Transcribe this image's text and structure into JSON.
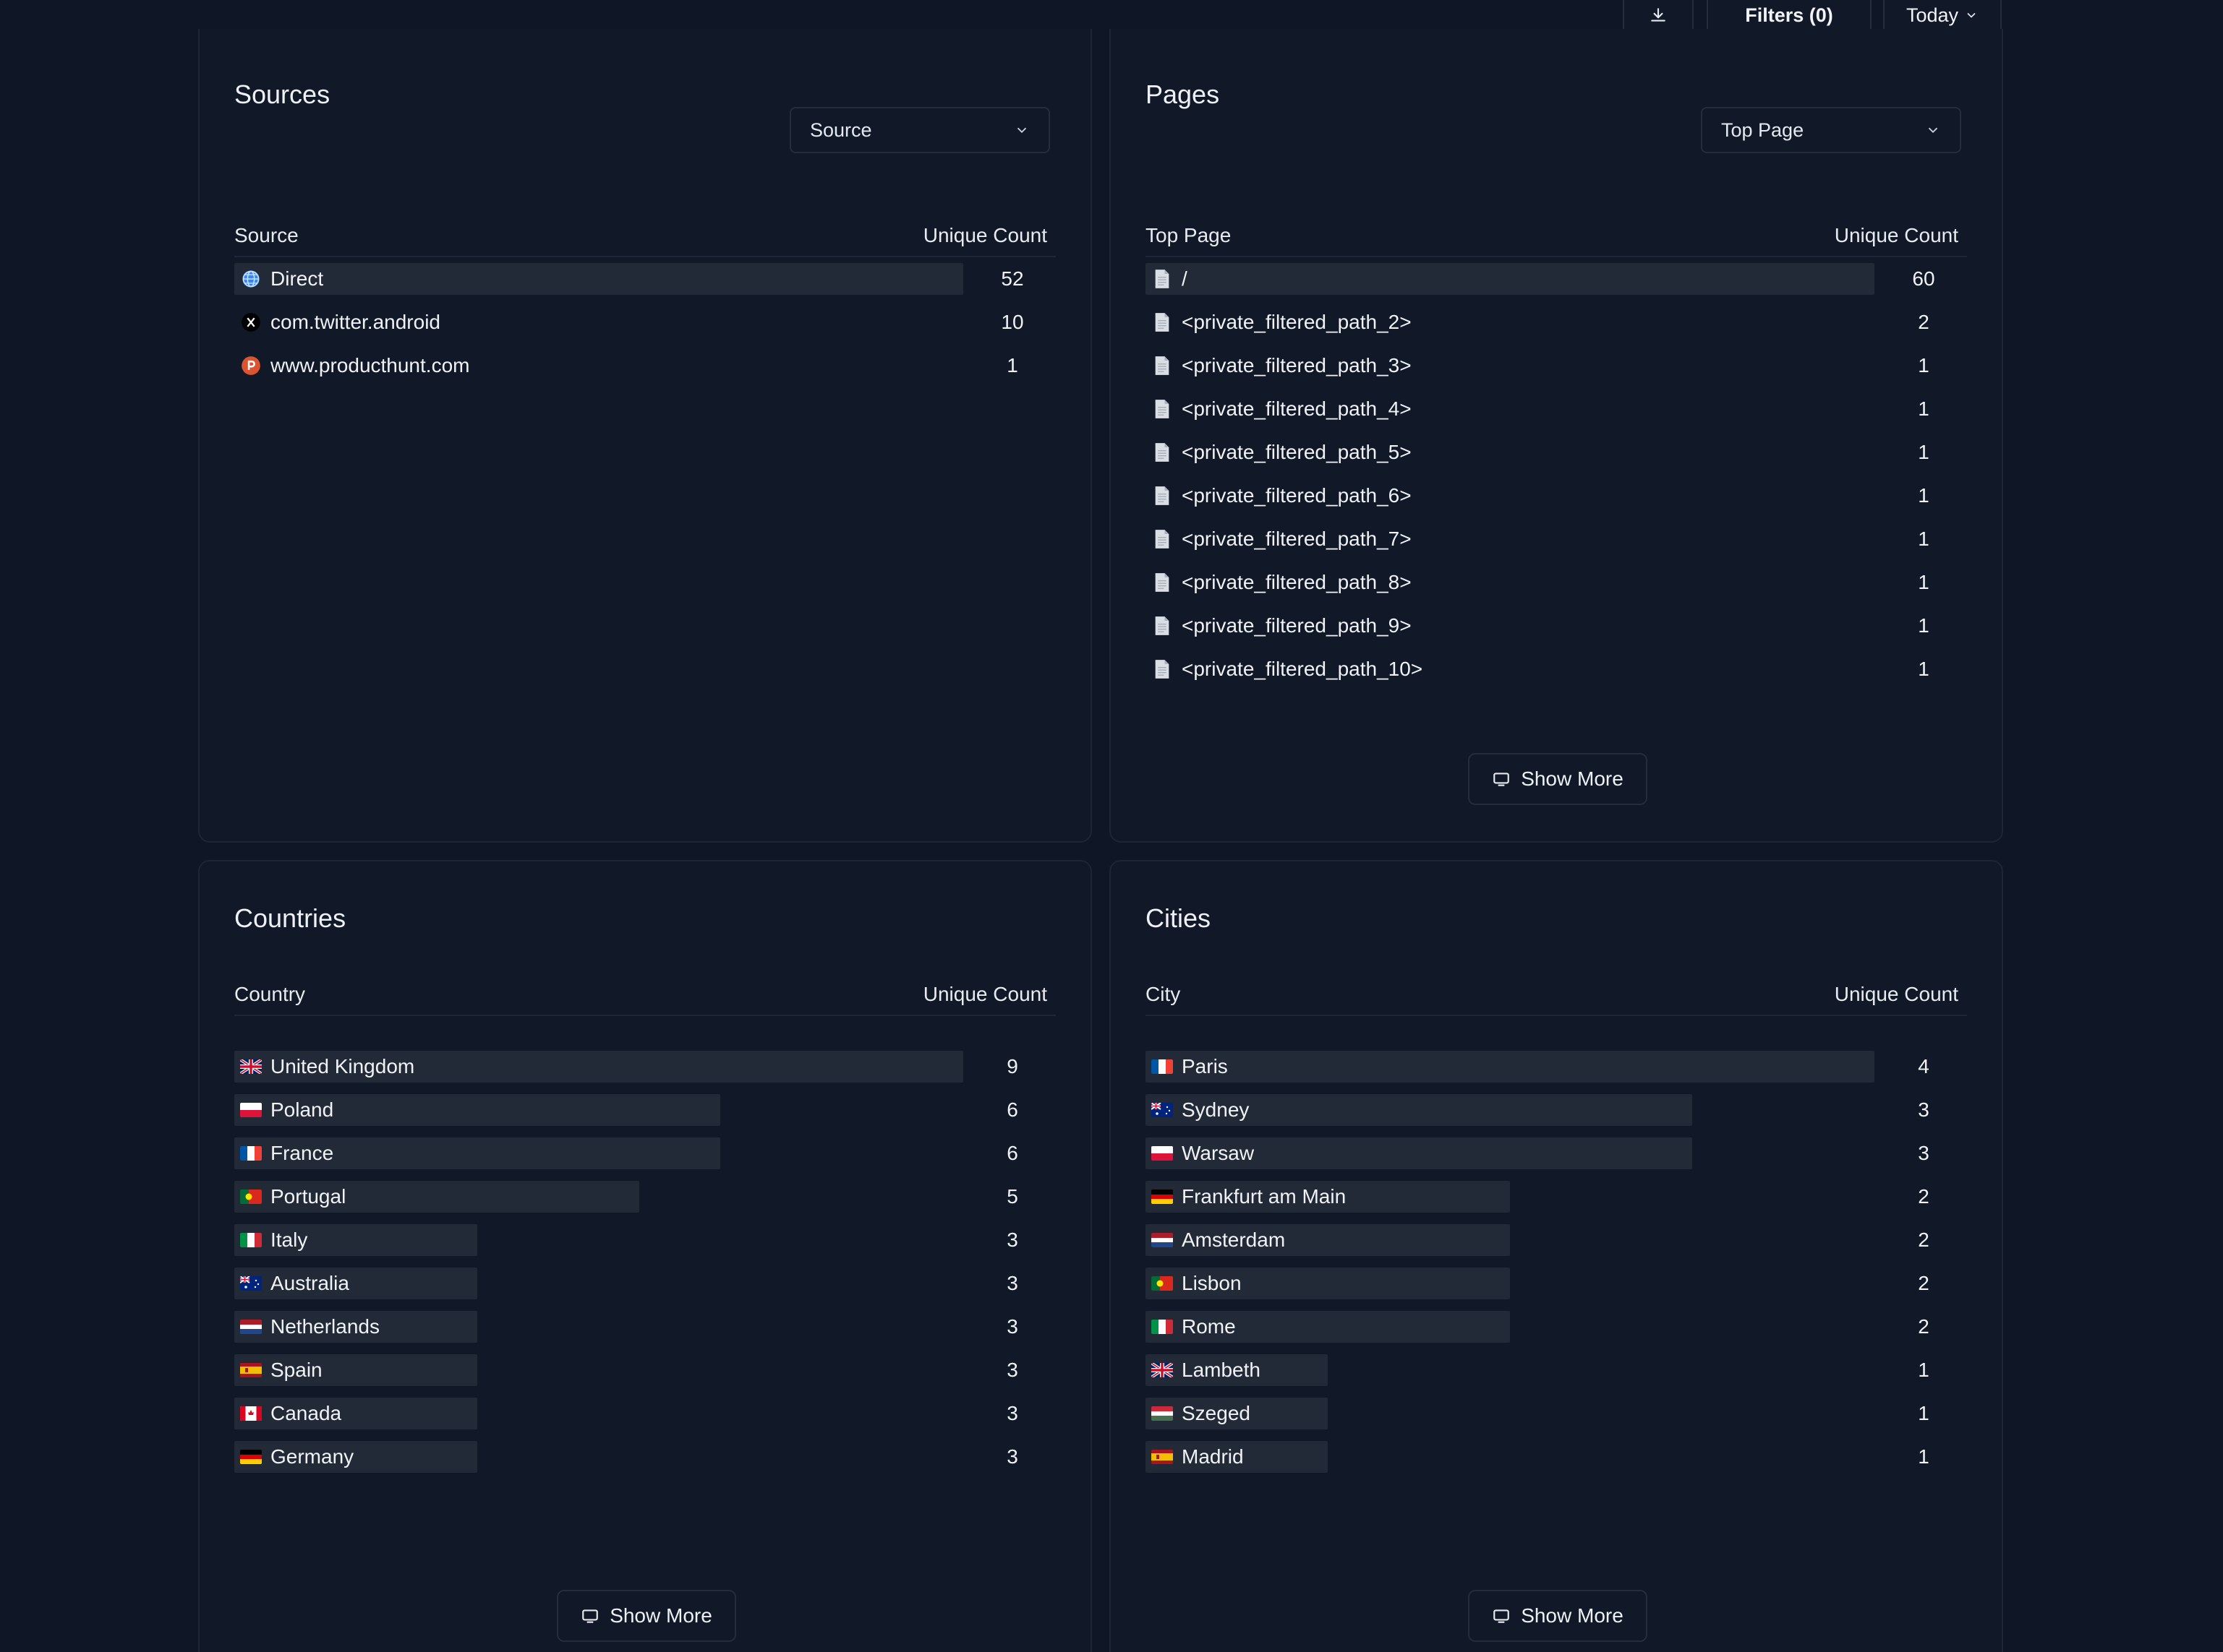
{
  "toolbar": {
    "download_icon": "download-icon",
    "filters_label": "Filters (0)",
    "range_label": "Today"
  },
  "sources": {
    "title": "Sources",
    "select_value": "Source",
    "col_name": "Source",
    "col_count": "Unique Count",
    "rows": [
      {
        "label": "Direct",
        "count": "52",
        "icon": "globe-icon",
        "share": 1.0
      },
      {
        "label": "com.twitter.android",
        "count": "10",
        "icon": "x-logo-icon",
        "share": 0.0
      },
      {
        "label": "www.producthunt.com",
        "count": "1",
        "icon": "producthunt-logo-icon",
        "share": 0.0
      }
    ]
  },
  "pages": {
    "title": "Pages",
    "select_value": "Top Page",
    "col_name": "Top Page",
    "col_count": "Unique Count",
    "rows": [
      {
        "label": "/",
        "count": "60",
        "share": 1.0
      },
      {
        "label": "<private_filtered_path_2>",
        "count": "2",
        "share": 0.0
      },
      {
        "label": "<private_filtered_path_3>",
        "count": "1",
        "share": 0.0
      },
      {
        "label": "<private_filtered_path_4>",
        "count": "1",
        "share": 0.0
      },
      {
        "label": "<private_filtered_path_5>",
        "count": "1",
        "share": 0.0
      },
      {
        "label": "<private_filtered_path_6>",
        "count": "1",
        "share": 0.0
      },
      {
        "label": "<private_filtered_path_7>",
        "count": "1",
        "share": 0.0
      },
      {
        "label": "<private_filtered_path_8>",
        "count": "1",
        "share": 0.0
      },
      {
        "label": "<private_filtered_path_9>",
        "count": "1",
        "share": 0.0
      },
      {
        "label": "<private_filtered_path_10>",
        "count": "1",
        "share": 0.0
      }
    ],
    "show_more": "Show More"
  },
  "countries": {
    "title": "Countries",
    "col_name": "Country",
    "col_count": "Unique Count",
    "rows": [
      {
        "label": "United Kingdom",
        "count": "9",
        "flag": "gb",
        "share": 1.0
      },
      {
        "label": "Poland",
        "count": "6",
        "flag": "pl",
        "share": 0.667
      },
      {
        "label": "France",
        "count": "6",
        "flag": "fr",
        "share": 0.667
      },
      {
        "label": "Portugal",
        "count": "5",
        "flag": "pt",
        "share": 0.556
      },
      {
        "label": "Italy",
        "count": "3",
        "flag": "it",
        "share": 0.333
      },
      {
        "label": "Australia",
        "count": "3",
        "flag": "au",
        "share": 0.333
      },
      {
        "label": "Netherlands",
        "count": "3",
        "flag": "nl",
        "share": 0.333
      },
      {
        "label": "Spain",
        "count": "3",
        "flag": "es",
        "share": 0.333
      },
      {
        "label": "Canada",
        "count": "3",
        "flag": "ca",
        "share": 0.333
      },
      {
        "label": "Germany",
        "count": "3",
        "flag": "de",
        "share": 0.333
      }
    ],
    "show_more": "Show More"
  },
  "cities": {
    "title": "Cities",
    "col_name": "City",
    "col_count": "Unique Count",
    "rows": [
      {
        "label": "Paris",
        "count": "4",
        "flag": "fr",
        "share": 1.0
      },
      {
        "label": "Sydney",
        "count": "3",
        "flag": "au",
        "share": 0.75
      },
      {
        "label": "Warsaw",
        "count": "3",
        "flag": "pl",
        "share": 0.75
      },
      {
        "label": "Frankfurt am Main",
        "count": "2",
        "flag": "de",
        "share": 0.5
      },
      {
        "label": "Amsterdam",
        "count": "2",
        "flag": "nl",
        "share": 0.5
      },
      {
        "label": "Lisbon",
        "count": "2",
        "flag": "pt",
        "share": 0.5
      },
      {
        "label": "Rome",
        "count": "2",
        "flag": "it",
        "share": 0.5
      },
      {
        "label": "Lambeth",
        "count": "1",
        "flag": "gb",
        "share": 0.25
      },
      {
        "label": "Szeged",
        "count": "1",
        "flag": "hu",
        "share": 0.25
      },
      {
        "label": "Madrid",
        "count": "1",
        "flag": "es",
        "share": 0.25
      }
    ],
    "show_more": "Show More"
  }
}
